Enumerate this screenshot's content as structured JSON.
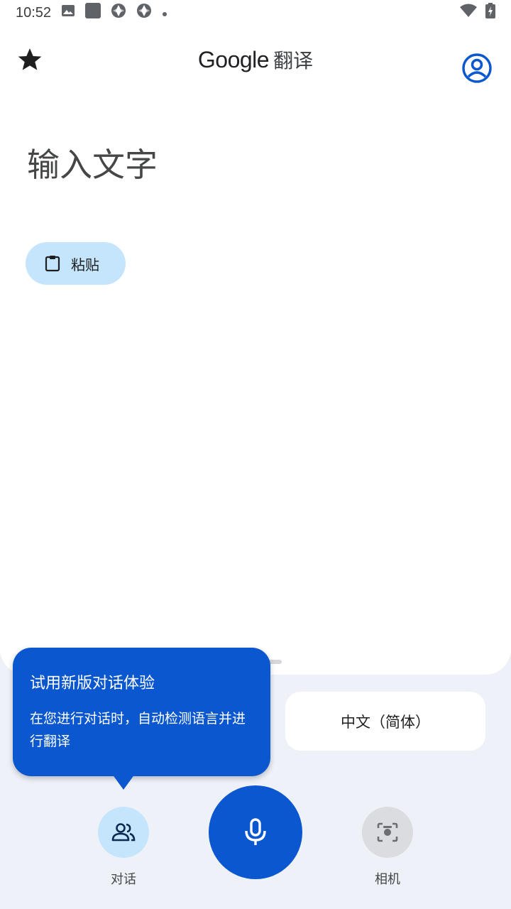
{
  "status_bar": {
    "time": "10:52",
    "left_icons": [
      "image-icon",
      "square-icon",
      "aperture-icon",
      "aperture-icon",
      "dot-icon"
    ],
    "right_icons": [
      "wifi-icon",
      "battery-icon"
    ]
  },
  "app_bar": {
    "title_brand": "Google",
    "title_product": "翻译",
    "left_icon": "star-icon",
    "right_icon": "account-circle-icon",
    "accent_color": "#0b57d0"
  },
  "input": {
    "placeholder": "输入文字"
  },
  "paste_button": {
    "label": "粘贴",
    "icon": "clipboard-icon"
  },
  "language": {
    "target": "中文（简体）"
  },
  "tooltip": {
    "title": "试用新版对话体验",
    "body": "在您进行对话时，自动检测语言并进行翻译"
  },
  "actions": {
    "conversation": {
      "label": "对话",
      "icon": "people-icon"
    },
    "microphone": {
      "icon": "mic-icon"
    },
    "camera": {
      "label": "相机",
      "icon": "camera-lens-icon"
    }
  }
}
